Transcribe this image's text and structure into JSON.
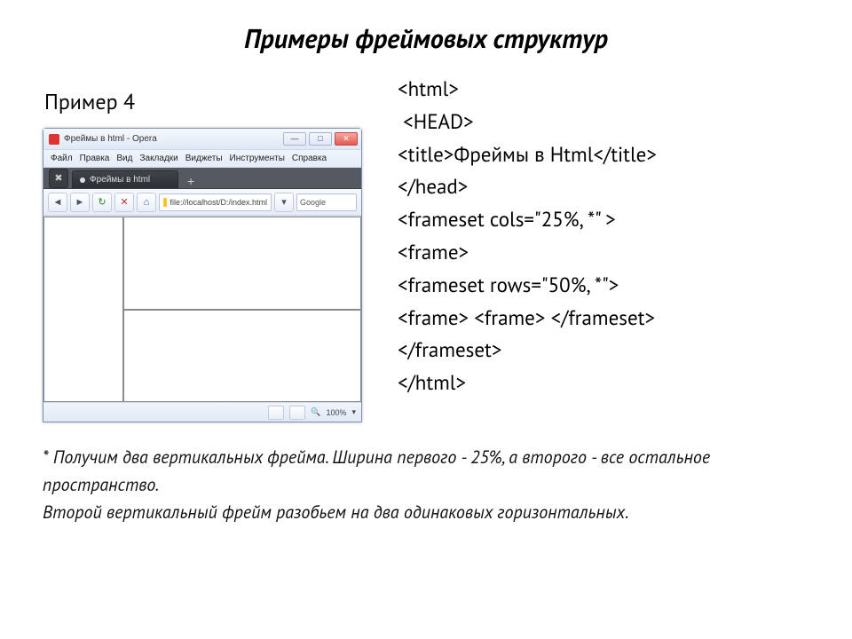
{
  "slide": {
    "title": "Примеры фреймовых структур",
    "example_label": "Пример 4"
  },
  "browser": {
    "window_title": "Фреймы в html - Opera",
    "menus": [
      "Файл",
      "Правка",
      "Вид",
      "Закладки",
      "Виджеты",
      "Инструменты",
      "Справка"
    ],
    "tab_label": "Фреймы в html",
    "address": "file://localhost/D:/index.html",
    "search_placeholder": "Google",
    "zoom": "100%",
    "win_min": "—",
    "win_max": "□",
    "win_close": "✕",
    "nav_back": "◄",
    "nav_fwd": "►",
    "nav_reload": "↻",
    "nav_stop": "✕",
    "nav_home": "⌂",
    "dropdown": "▾",
    "status_icon1": "🔍",
    "status_icon2": "⚙",
    "tab_plus": "+"
  },
  "code": {
    "l1": "<html>",
    "l2": " <HEAD>",
    "l3": "<title>Фреймы в Html</title>",
    "l4": "</head>",
    "l5": "<frameset cols=\"25%, *\" >",
    "l6": "<frame>",
    "l7": "<frameset rows=\"50%, *\">",
    "l8": "<frame> <frame> </frameset>",
    "l9": "</frameset>",
    "l10": "</html>"
  },
  "footnote": {
    "p1": "* Получим два вертикальных фрейма. Ширина первого - 25%, а второго - все остальное пространство.",
    "p2": "Второй вертикальный фрейм разобьем на два одинаковых горизонтальных."
  }
}
